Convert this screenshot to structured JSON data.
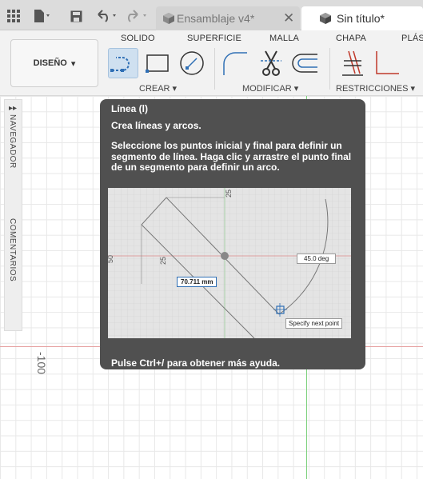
{
  "topbar": {
    "icons": [
      "grid-menu-icon",
      "file-icon",
      "save-icon",
      "undo-icon",
      "redo-icon"
    ],
    "tabs": [
      {
        "label": "Ensamblaje v4*",
        "active": false,
        "close": "✕"
      },
      {
        "label": "Sin título*",
        "active": true
      }
    ]
  },
  "ribbon": {
    "tabs": [
      "SOLIDO",
      "SUPERFICIE",
      "MALLA",
      "CHAPA",
      "PLÁS"
    ],
    "workspace": {
      "label": "DISEÑO",
      "caret": "▾"
    },
    "groups": {
      "crear": "CREAR ▾",
      "modificar": "MODIFICAR ▾",
      "restricciones": "RESTRICCIONES ▾"
    }
  },
  "sidepanel": {
    "navegador": "NAVEGADOR",
    "comentarios": "COMENTARIOS",
    "arrow": "▸▸"
  },
  "canvas": {
    "axis_label": "-100"
  },
  "tooltip": {
    "title": "Línea (l)",
    "description": "Crea líneas y arcos.",
    "body": "Seleccione los puntos inicial y final para definir un segmento de línea. Haga clic y arrastre el punto final de un segmento para definir un arco.",
    "footer": "Pulse Ctrl+/ para obtener más ayuda.",
    "image": {
      "dim_top": "25",
      "dim_left": "25",
      "dim_left_edge": "50",
      "length_label": "70.711 mm",
      "angle_label": "45.0 deg",
      "prompt_label": "Specify next point"
    }
  },
  "colors": {
    "tooltip_bg": "#505050",
    "x_axis": "#e6a0a0",
    "y_axis": "#7bd07b",
    "selected_tool": "#cfe0f0",
    "constraint_red": "#c0392b"
  }
}
